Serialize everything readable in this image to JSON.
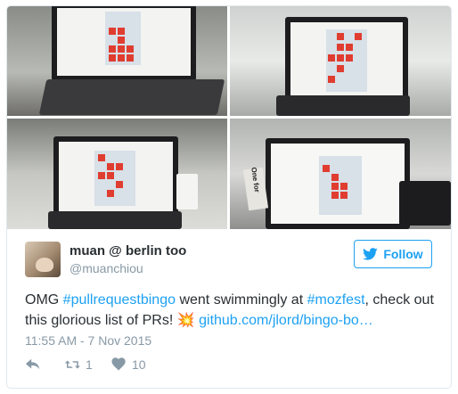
{
  "tweet": {
    "display_name": "muan @ berlin too",
    "handle": "@muanchiou",
    "follow_label": "Follow",
    "text_parts": {
      "t1": "OMG ",
      "hashtag1": "#pullrequestbingo",
      "t2": " went swimmingly at ",
      "hashtag2": "#mozfest",
      "t3": ", check out this glorious list of PRs! ",
      "emoji": "💥",
      "t4": " ",
      "link": "github.com/jlord/bingo-bo…"
    },
    "timestamp": "11:55 AM - 7 Nov 2015",
    "retweet_count": "1",
    "like_count": "10"
  },
  "photo_sign_text": "One for",
  "colors": {
    "accent": "#1da1f2",
    "text": "#292f33",
    "muted": "#8899a6",
    "bingo_red": "#e03d31"
  },
  "icons": [
    "twitter-bird-icon",
    "reply-icon",
    "retweet-icon",
    "heart-icon"
  ]
}
